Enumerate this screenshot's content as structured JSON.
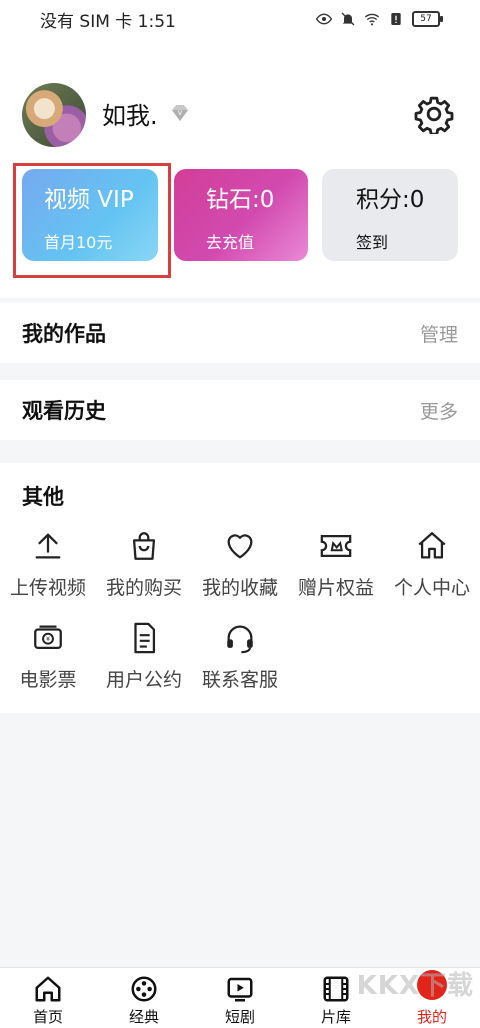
{
  "status_bar": {
    "carrier_time": "没有 SIM 卡 1:51",
    "battery": "57"
  },
  "profile": {
    "username": "如我."
  },
  "cards": {
    "vip": {
      "title": "视频 VIP",
      "sub": "首月10元"
    },
    "diamond": {
      "title": "钻石:0",
      "sub": "去充值"
    },
    "points": {
      "title": "积分:0",
      "sub": "签到"
    }
  },
  "sections": {
    "works": {
      "title": "我的作品",
      "action": "管理"
    },
    "history": {
      "title": "观看历史",
      "action": "更多"
    }
  },
  "others": {
    "title": "其他",
    "items": [
      {
        "label": "上传视频",
        "icon": "upload-icon"
      },
      {
        "label": "我的购买",
        "icon": "shopping-bag-icon"
      },
      {
        "label": "我的收藏",
        "icon": "heart-icon"
      },
      {
        "label": "赠片权益",
        "icon": "ticket-crown-icon"
      },
      {
        "label": "个人中心",
        "icon": "home-icon"
      },
      {
        "label": "电影票",
        "icon": "movie-ticket-icon"
      },
      {
        "label": "用户公约",
        "icon": "document-icon"
      },
      {
        "label": "联系客服",
        "icon": "headset-icon"
      }
    ]
  },
  "tabs": [
    {
      "label": "首页",
      "icon": "home-icon"
    },
    {
      "label": "经典",
      "icon": "film-reel-icon"
    },
    {
      "label": "短剧",
      "icon": "play-screen-icon"
    },
    {
      "label": "片库",
      "icon": "film-strip-icon"
    },
    {
      "label": "我的",
      "icon": "profile-badge-icon"
    }
  ],
  "watermark": "KKX下载",
  "colors": {
    "accent": "#e1251b",
    "highlight": "#d93f3f"
  }
}
